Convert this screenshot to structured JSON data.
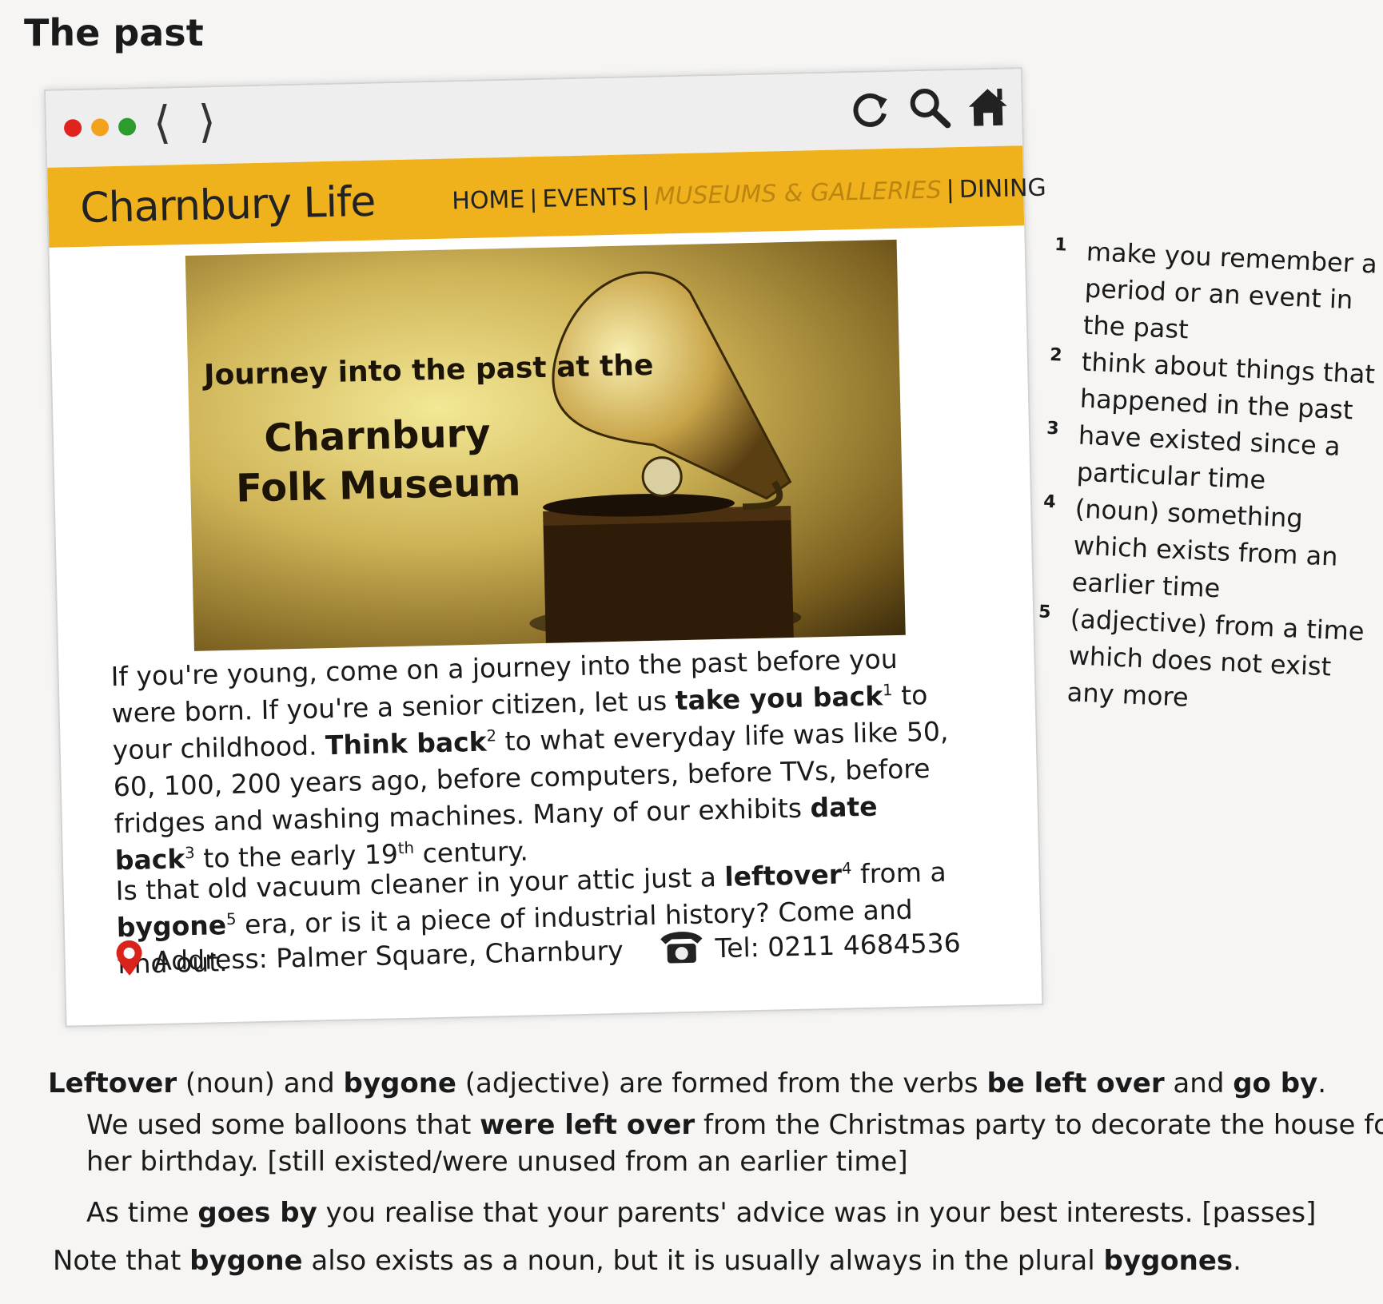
{
  "section_title": "The past",
  "browser": {
    "window_dot_colors": [
      "#e0231c",
      "#f2a31b",
      "#2e9b2e"
    ],
    "back_glyph": "⟨",
    "forward_glyph": "⟩",
    "icons": [
      "refresh-icon",
      "search-icon",
      "home-icon"
    ]
  },
  "site": {
    "name": "Charnbury Life",
    "nav": [
      "HOME",
      "EVENTS",
      "MUSEUMS & GALLERIES",
      "DINING"
    ],
    "nav_separator": "|",
    "accent_color": "#f0b21c"
  },
  "hero": {
    "line1": "Journey into the past at the",
    "line2": "Charnbury",
    "line3": "Folk Museum"
  },
  "article": {
    "p1": [
      "If you're young, come on a journey into the past before you were born. If you're a senior citizen, let us ",
      "take you back",
      "1",
      " to your childhood. ",
      "Think back",
      "2",
      " to what everyday life was like 50, 60, 100, 200 years ago, before computers, before TVs, before fridges and washing machines. Many of our exhibits ",
      "date back",
      "3",
      " to the early 19",
      "th",
      " century."
    ],
    "p2": [
      "Is that old vacuum cleaner in your attic just a ",
      "leftover",
      "4",
      " from a ",
      "bygone",
      "5",
      " era, or is it a piece of industrial history? Come and find out."
    ],
    "address": "Address: Palmer Square, Charnbury",
    "tel": "Tel: 0211 4684536"
  },
  "definitions": [
    {
      "num": "1",
      "text": "make you remember a period or an event in the past"
    },
    {
      "num": "2",
      "text": "think about things that happened in the past"
    },
    {
      "num": "3",
      "text": "have existed since a particular time"
    },
    {
      "num": "4",
      "text": "(noun) something which exists from an earlier time"
    },
    {
      "num": "5",
      "text": "(adjective) from a time which does not exist any more"
    }
  ],
  "notes": {
    "n1": [
      "Leftover",
      " (noun) and ",
      "bygone",
      " (adjective) are formed from the verbs ",
      "be left over",
      " and ",
      "go by",
      "."
    ],
    "n2a": [
      "We used some balloons that ",
      "were left over",
      " from the Christmas party to decorate the house for"
    ],
    "n2b": "her birthday. [still existed/were unused from an earlier time]",
    "n3": [
      "As time ",
      "goes by",
      " you realise that your parents' advice was in your best interests. [passes]"
    ],
    "n4": [
      "Note that ",
      "bygone",
      " also exists as a noun, but it is usually always in the plural ",
      "bygones",
      "."
    ]
  }
}
